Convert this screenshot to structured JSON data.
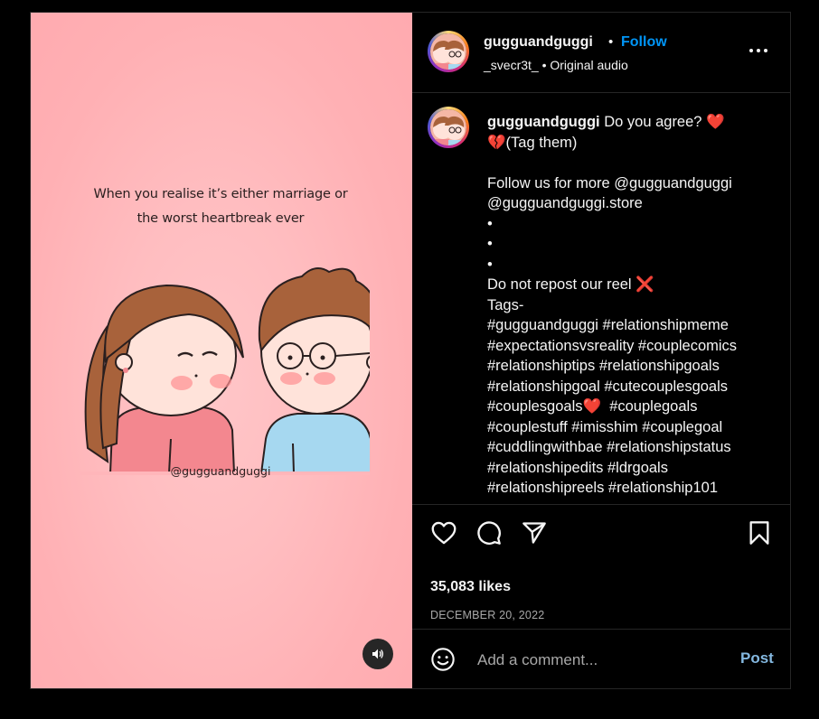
{
  "media": {
    "caption_line1": "When you realise it’s either marriage or",
    "caption_line2": "the worst heartbreak ever",
    "watermark": "@gugguandguggi",
    "audio_icon": "speaker-icon"
  },
  "header": {
    "username": "gugguandguggi",
    "separator": "•",
    "follow_label": "Follow",
    "audio_source": "_svecr3t_ • Original audio",
    "more_icon": "more-horizontal-icon"
  },
  "caption": {
    "username": "gugguandguggi",
    "text": " Do you agree? ❤️\n💔(Tag them)\n\nFollow us for more @gugguandguggi\n@gugguandguggi.store\n•\n•\n•\nDo not repost our reel ❌\nTags-\n#gugguandguggi #relationshipmeme\n#expectationsvsreality #couplecomics\n#relationshiptips #relationshipgoals\n#relationshipgoal #cutecouplesgoals\n#couplesgoals❤️  #couplegoals\n#couplestuff #imisshim #couplegoal\n#cuddlingwithbae #relationshipstatus\n#relationshipedits #ldrgoals\n#relationshipreels #relationship101"
  },
  "actions": {
    "like_icon": "heart-icon",
    "comment_icon": "comment-icon",
    "share_icon": "send-icon",
    "save_icon": "bookmark-icon",
    "likes": "35,083 likes",
    "date": "DECEMBER 20, 2022"
  },
  "comment_box": {
    "emoji_icon": "emoji-icon",
    "placeholder": "Add a comment...",
    "post_label": "Post"
  },
  "colors": {
    "follow": "#0095f6",
    "post": "#84b8e0",
    "media_bg": "#ffb6ba"
  }
}
